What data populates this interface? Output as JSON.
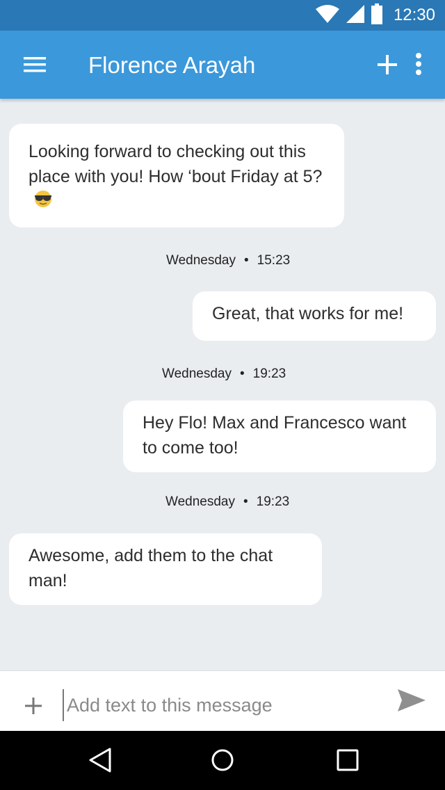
{
  "status_bar": {
    "time": "12:30",
    "icons": [
      "wifi-icon",
      "cell-signal-icon",
      "battery-icon"
    ]
  },
  "app_bar": {
    "title": "Florence Arayah",
    "background": "#3b98da"
  },
  "messages": [
    {
      "direction": "incoming",
      "text": "Looking forward to checking out this place with you! How ‘bout Friday at 5?",
      "emoji": "sunglasses-emoji"
    },
    {
      "direction": "outgoing",
      "text": "Great, that works for me!"
    },
    {
      "direction": "outgoing",
      "text": "Hey Flo! Max and Francesco want to come too!"
    },
    {
      "direction": "incoming",
      "text": "Awesome, add them to the chat man!"
    }
  ],
  "timestamps": [
    {
      "day": "Wednesday",
      "time": "15:23"
    },
    {
      "day": "Wednesday",
      "time": "19:23"
    },
    {
      "day": "Wednesday",
      "time": "19:23"
    }
  ],
  "composer": {
    "placeholder": "Add text to this message",
    "value": ""
  },
  "colors": {
    "status_bar": "#2a78b5",
    "background": "#eaedf0",
    "bubble": "#ffffff"
  }
}
